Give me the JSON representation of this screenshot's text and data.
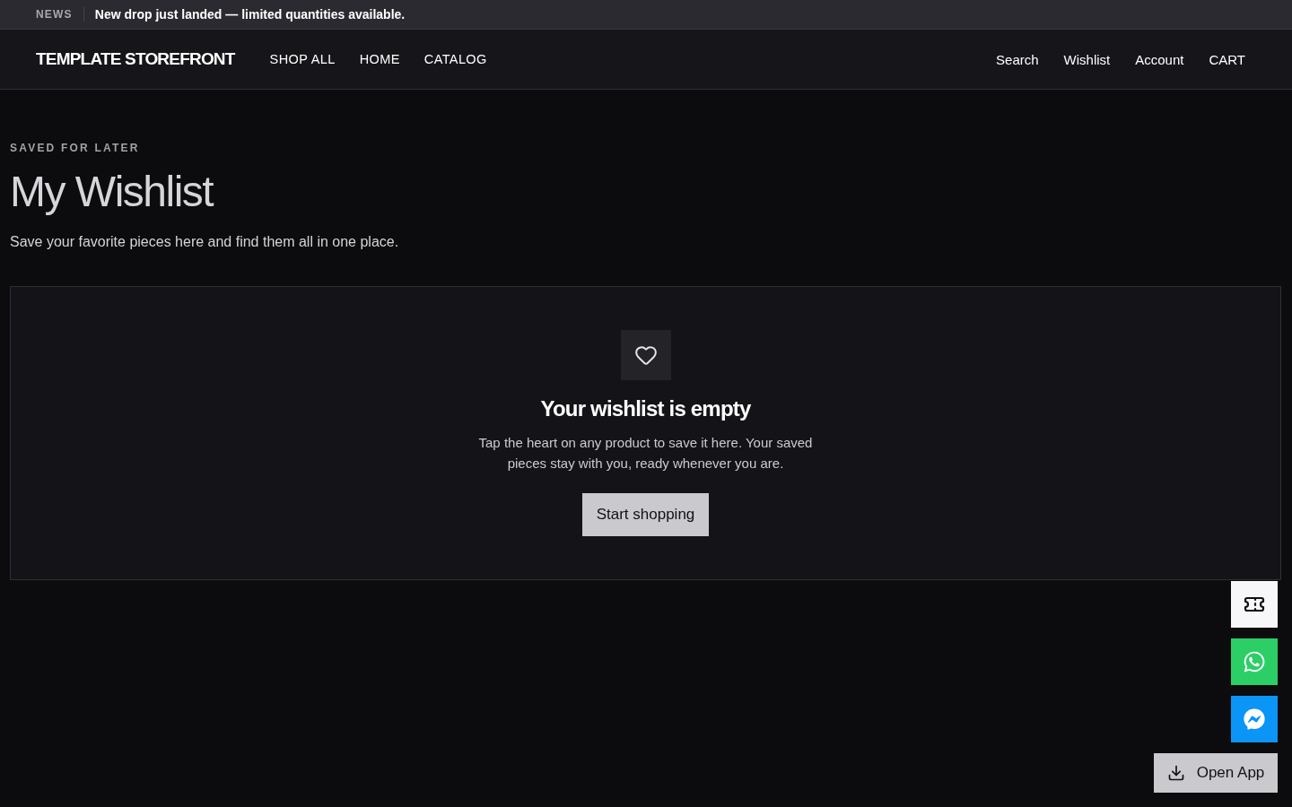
{
  "announcement": {
    "label": "NEWS",
    "message": "New drop just landed — limited quantities available."
  },
  "header": {
    "logo": "TEMPLATE STOREFRONT",
    "nav": [
      {
        "label": "SHOP ALL"
      },
      {
        "label": "HOME"
      },
      {
        "label": "CATALOG"
      }
    ],
    "actions": [
      {
        "label": "Search"
      },
      {
        "label": "Wishlist"
      },
      {
        "label": "Account"
      },
      {
        "label": "CART"
      }
    ]
  },
  "page": {
    "eyebrow": "SAVED FOR LATER",
    "title": "My Wishlist",
    "subtitle": "Save your favorite pieces here and find them all in one place."
  },
  "empty_state": {
    "title": "Your wishlist is empty",
    "message": "Tap the heart on any product to save it here. Your saved pieces stay with you, ready whenever you are.",
    "button": "Start shopping"
  },
  "app_button": {
    "label": "Open App"
  }
}
